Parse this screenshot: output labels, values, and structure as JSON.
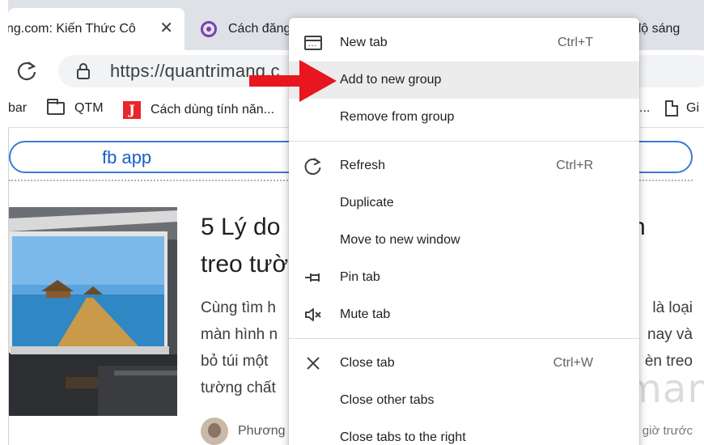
{
  "tabs": [
    {
      "title": "ng.com: Kiến Thức Cô",
      "close": "✕"
    },
    {
      "title": "Cách đăng"
    },
    {
      "title": "g độ sáng"
    }
  ],
  "toolbar": {
    "url": "https://quantrimang.c",
    "icons": [
      "reload-icon",
      "lock-icon"
    ]
  },
  "bookmarks": [
    {
      "label": "bar"
    },
    {
      "label": "QTM",
      "icon": "folder-icon"
    },
    {
      "label": "Cách dùng tính năn...",
      "icon": "j-icon"
    },
    {
      "label": "..."
    },
    {
      "label": "Gi",
      "icon": "page-icon"
    }
  ],
  "page": {
    "search_text": "fb app",
    "headline_line1": "5 Lý do",
    "headline_line2": "treo tườ",
    "headline_tail": "n",
    "excerpt": [
      "Cùng tìm h",
      "màn hình n",
      "bỏ túi một",
      "tường chất"
    ],
    "excerpt_right": [
      "là loại",
      "nay và",
      "èn treo",
      ""
    ],
    "author": "Phương",
    "time_ago": "giờ trước",
    "watermark": "uantrimang"
  },
  "context_menu": {
    "items": [
      {
        "label": "New tab",
        "shortcut": "Ctrl+T",
        "icon": "new-tab-icon"
      },
      {
        "label": "Add to new group",
        "shortcut": "",
        "highlighted": true
      },
      {
        "label": "Remove from group",
        "shortcut": ""
      },
      {
        "label": "Refresh",
        "shortcut": "Ctrl+R",
        "icon": "refresh-icon"
      },
      {
        "label": "Duplicate",
        "shortcut": ""
      },
      {
        "label": "Move to new window",
        "shortcut": ""
      },
      {
        "label": "Pin tab",
        "shortcut": "",
        "icon": "pin-icon"
      },
      {
        "label": "Mute tab",
        "shortcut": "",
        "icon": "mute-icon"
      },
      {
        "label": "Close tab",
        "shortcut": "Ctrl+W",
        "icon": "close-icon"
      },
      {
        "label": "Close other tabs",
        "shortcut": ""
      },
      {
        "label": "Close tabs to the right",
        "shortcut": ""
      }
    ]
  },
  "colors": {
    "highlight": "#ececec",
    "accent_arrow": "#e8161e",
    "search_border": "#3a7bd5",
    "search_text": "#1a5fc4"
  }
}
